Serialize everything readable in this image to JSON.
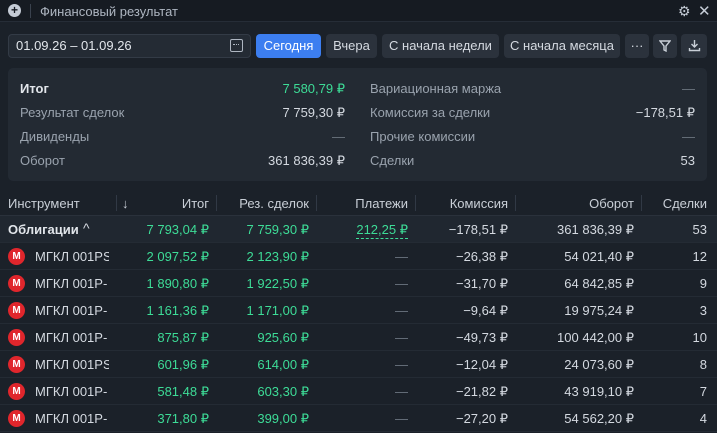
{
  "window": {
    "title": "Финансовый результат"
  },
  "toolbar": {
    "date_range": "01.09.26 – 01.09.26",
    "today": "Сегодня",
    "yesterday": "Вчера",
    "since_week": "С начала недели",
    "since_month": "С начала месяца",
    "more": "···"
  },
  "summary": {
    "total_label": "Итог",
    "total_value": "7 580,79 ₽",
    "deals_result_label": "Результат сделок",
    "deals_result_value": "7 759,30 ₽",
    "dividends_label": "Дивиденды",
    "dividends_value": "—",
    "turnover_label": "Оборот",
    "turnover_value": "361 836,39 ₽",
    "margin_label": "Вариационная маржа",
    "margin_value": "—",
    "commission_label": "Комиссия за сделки",
    "commission_value": "−178,51 ₽",
    "other_commission_label": "Прочие комиссии",
    "other_commission_value": "—",
    "trades_label": "Сделки",
    "trades_value": "53"
  },
  "table": {
    "headers": {
      "instrument": "Инструмент",
      "sort": "↓",
      "total": "Итог",
      "deals_result": "Рез. сделок",
      "payments": "Платежи",
      "commission": "Комиссия",
      "turnover": "Оборот",
      "trades": "Сделки"
    },
    "group": {
      "name": "Облигации",
      "chevron": "^",
      "total": "7 793,04 ₽",
      "deals_result": "7 759,30 ₽",
      "payments": "212,25 ₽",
      "commission": "−178,51 ₽",
      "turnover": "361 836,39 ₽",
      "trades": "53"
    },
    "rows": [
      {
        "name": "МГКЛ 001PS",
        "total": "2 097,52 ₽",
        "deals_result": "2 123,90 ₽",
        "payments": "—",
        "commission": "−26,38 ₽",
        "turnover": "54 021,40 ₽",
        "trades": "12"
      },
      {
        "name": "МГКЛ 001Р-",
        "total": "1 890,80 ₽",
        "deals_result": "1 922,50 ₽",
        "payments": "—",
        "commission": "−31,70 ₽",
        "turnover": "64 842,85 ₽",
        "trades": "9"
      },
      {
        "name": "МГКЛ 001Р-",
        "total": "1 161,36 ₽",
        "deals_result": "1 171,00 ₽",
        "payments": "—",
        "commission": "−9,64 ₽",
        "turnover": "19 975,24 ₽",
        "trades": "3"
      },
      {
        "name": "МГКЛ 001Р-",
        "total": "875,87 ₽",
        "deals_result": "925,60 ₽",
        "payments": "—",
        "commission": "−49,73 ₽",
        "turnover": "100 442,00 ₽",
        "trades": "10"
      },
      {
        "name": "МГКЛ 001PS",
        "total": "601,96 ₽",
        "deals_result": "614,00 ₽",
        "payments": "—",
        "commission": "−12,04 ₽",
        "turnover": "24 073,60 ₽",
        "trades": "8"
      },
      {
        "name": "МГКЛ 001Р-",
        "total": "581,48 ₽",
        "deals_result": "603,30 ₽",
        "payments": "—",
        "commission": "−21,82 ₽",
        "turnover": "43 919,10 ₽",
        "trades": "7"
      },
      {
        "name": "МГКЛ 001Р-",
        "total": "371,80 ₽",
        "deals_result": "399,00 ₽",
        "payments": "—",
        "commission": "−27,20 ₽",
        "turnover": "54 562,20 ₽",
        "trades": "4"
      }
    ]
  },
  "icons": {
    "issuer": "М"
  },
  "colors": {
    "accent": "#3c7ef0",
    "positive": "#3ddc97",
    "issuer_icon": "#e0262c"
  }
}
